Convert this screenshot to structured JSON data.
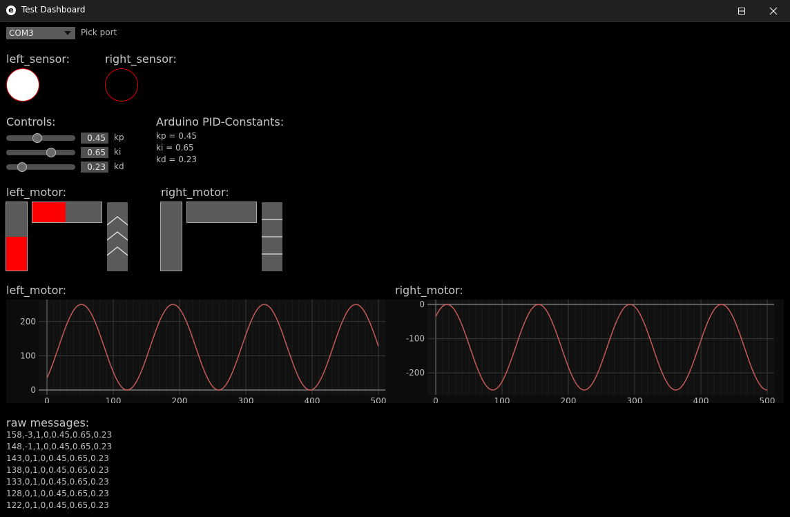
{
  "window": {
    "title": "Test Dashboard",
    "icon": "e"
  },
  "port": {
    "selected": "COM3",
    "label": "Pick port"
  },
  "sensors": {
    "left_label": "left_sensor:",
    "right_label": "right_sensor:",
    "left_active": true,
    "right_active": false
  },
  "controls": {
    "title": "Controls:",
    "sliders": [
      {
        "name": "kp",
        "value": "0.45",
        "fraction": 0.45
      },
      {
        "name": "ki",
        "value": "0.65",
        "fraction": 0.65
      },
      {
        "name": "kd",
        "value": "0.23",
        "fraction": 0.23
      }
    ]
  },
  "pid": {
    "title": "Arduino PID-Constants:",
    "lines": [
      "kp = 0.45",
      "ki = 0.65",
      "kd = 0.23"
    ]
  },
  "motors": {
    "left": {
      "label": "left_motor:",
      "vertical_level": 0.5,
      "horizontal_level": 0.48,
      "direction": "up"
    },
    "right": {
      "label": "right_motor:",
      "vertical_level": 0.0,
      "horizontal_level": 0.0,
      "direction": "stop"
    }
  },
  "chart_data": [
    {
      "type": "line",
      "title": "left_motor:",
      "xlim": [
        0,
        500
      ],
      "ylim": [
        0,
        250
      ],
      "xticks": [
        0,
        100,
        200,
        300,
        400,
        500
      ],
      "yticks": [
        0,
        100,
        200
      ],
      "series": [
        {
          "formula": "125 - 125*cos(2*pi*(x+17)/138)",
          "x_range": [
            0,
            500
          ],
          "color": "#c85a5a"
        }
      ]
    },
    {
      "type": "line",
      "title": "right_motor:",
      "xlim": [
        0,
        500
      ],
      "ylim": [
        -250,
        0
      ],
      "xticks": [
        0,
        100,
        200,
        300,
        400,
        500
      ],
      "yticks": [
        -200,
        -100,
        0
      ],
      "series": [
        {
          "formula": "-125 - 125*cos(2*pi*(x-86)/138)",
          "x_range": [
            0,
            500
          ],
          "color": "#c85a5a"
        }
      ]
    }
  ],
  "raw": {
    "title": "raw messages:",
    "lines": [
      "158,-3,1,0,0.45,0.65,0.23",
      "148,-1,1,0,0.45,0.65,0.23",
      "143,0,1,0,0.45,0.65,0.23",
      "138,0,1,0,0.45,0.65,0.23",
      "133,0,1,0,0.45,0.65,0.23",
      "128,0,1,0,0.45,0.65,0.23",
      "122,0,1,0,0.45,0.65,0.23"
    ]
  },
  "colors": {
    "accent": "#ff0000",
    "plot_line": "#c85a5a",
    "panel": "#5a5a5a"
  }
}
